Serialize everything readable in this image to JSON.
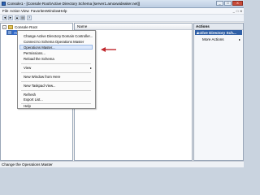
{
  "window": {
    "title": "Console1 - [Console Root\\Active Directory Schema [server1.amoxwideaker.net]]",
    "controls": {
      "minimize": "_",
      "maximize": "□",
      "close": "X"
    }
  },
  "menubar": {
    "items": [
      "File",
      "Action",
      "View",
      "Favorites",
      "Window",
      "Help"
    ],
    "mdi": [
      "_",
      "□",
      "X"
    ]
  },
  "toolbar": {
    "icons": [
      "back-icon",
      "forward-icon",
      "up-icon",
      "console-tree-icon",
      "help-icon"
    ]
  },
  "tree": {
    "root_label": "Console Root",
    "child_label": "Active Directory Schema"
  },
  "list": {
    "column_name": "Name"
  },
  "actions": {
    "header": "Actions",
    "subheader": "Active Directory Sch...",
    "more": "More Actions"
  },
  "context_menu": {
    "items": [
      "Change Active Directory Domain Controller...",
      "Connect to Schema Operations Master",
      "Operations Master...",
      "Permissions...",
      "Reload the Schema",
      "View",
      "New Window from Here",
      "New Taskpad View...",
      "Refresh",
      "Export List...",
      "Help"
    ],
    "selected_index": 2
  },
  "status": {
    "text": "Change the Operations Master"
  },
  "colors": {
    "selection": "#3168c6",
    "arrow": "#c0282e"
  }
}
